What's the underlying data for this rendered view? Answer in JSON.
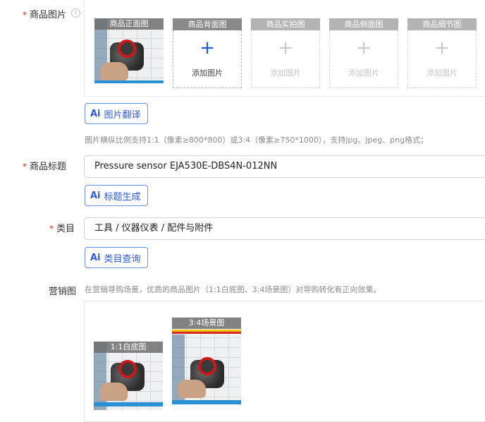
{
  "images_section": {
    "label": "商品图片",
    "required_mark": "*",
    "help_icon": "question-circle-icon",
    "slots": [
      {
        "title": "商品正面图",
        "state": "filled"
      },
      {
        "title": "商品背面图",
        "action": "添加图片",
        "state": "active"
      },
      {
        "title": "商品实拍图",
        "action": "添加图片",
        "state": "disabled"
      },
      {
        "title": "商品侧面图",
        "action": "添加图片",
        "state": "disabled"
      },
      {
        "title": "商品细节图",
        "action": "添加图片",
        "state": "disabled"
      }
    ],
    "plus_glyph": "+",
    "ai_button": {
      "badge": "Ai",
      "label": "图片翻译"
    },
    "hint": "图片横纵比例支持1:1（像素≥800*800）或3:4（像素≥750*1000），支持jpg、jpeg、png格式；"
  },
  "title_section": {
    "label": "商品标题",
    "required_mark": "*",
    "value": "Pressure sensor EJA530E-DBS4N-012NN",
    "ai_button": {
      "badge": "Ai",
      "label": "标题生成"
    }
  },
  "category_section": {
    "label": "类目",
    "required_mark": "*",
    "value": "工具 / 仪器仪表 / 配件与附件",
    "ai_button": {
      "badge": "Ai",
      "label": "类目查询"
    }
  },
  "marketing_section": {
    "label": "营销图",
    "hint": "在营销导购场景，优质的商品图片（1:1白底图、3:4场景图）对导购转化有正向效果。",
    "images": [
      {
        "caption": "1:1白底图"
      },
      {
        "caption": "3:4场景图"
      }
    ]
  },
  "colors": {
    "required": "#e2231a",
    "accent": "#1a5bd6",
    "ai_button_text": "#2f5ad8"
  }
}
